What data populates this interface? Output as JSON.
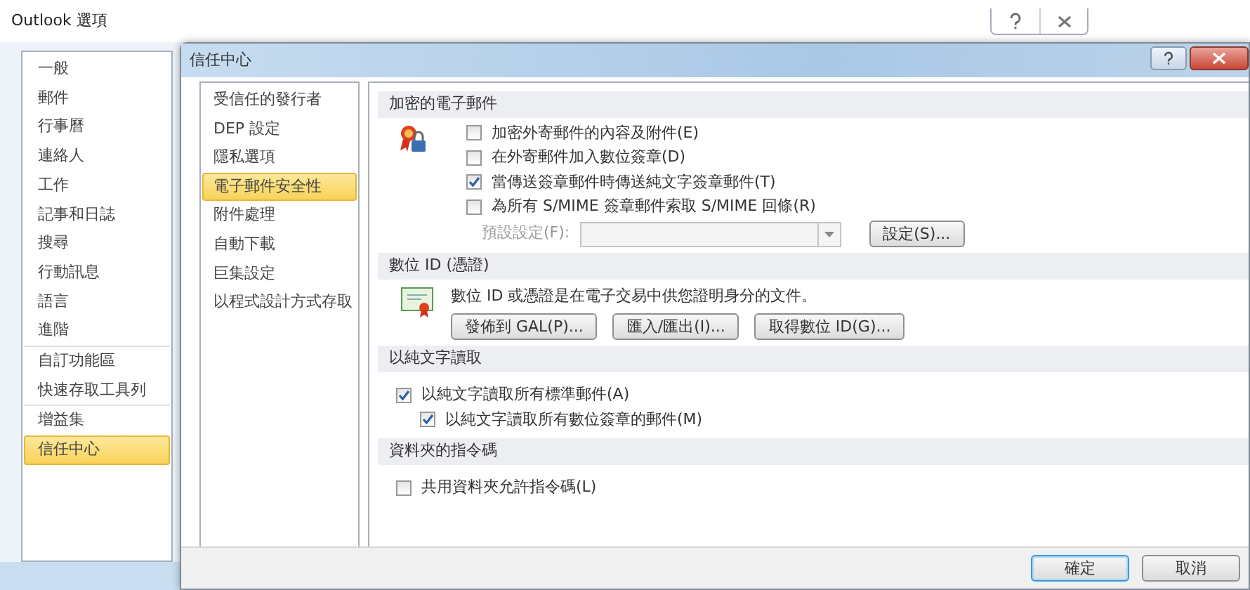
{
  "outer_window": {
    "title": "Outlook 選項",
    "nav_groups": [
      [
        {
          "label": "一般",
          "selected": false
        },
        {
          "label": "郵件",
          "selected": false
        },
        {
          "label": "行事曆",
          "selected": false
        },
        {
          "label": "連絡人",
          "selected": false
        },
        {
          "label": "工作",
          "selected": false
        },
        {
          "label": "記事和日誌",
          "selected": false
        },
        {
          "label": "搜尋",
          "selected": false
        },
        {
          "label": "行動訊息",
          "selected": false
        },
        {
          "label": "語言",
          "selected": false
        },
        {
          "label": "進階",
          "selected": false
        }
      ],
      [
        {
          "label": "自訂功能區",
          "selected": false
        },
        {
          "label": "快速存取工具列",
          "selected": false
        }
      ],
      [
        {
          "label": "增益集",
          "selected": false
        },
        {
          "label": "信任中心",
          "selected": true
        }
      ]
    ]
  },
  "dialog": {
    "title": "信任中心",
    "nav": [
      {
        "label": "受信任的發行者",
        "selected": false
      },
      {
        "label": "DEP 設定",
        "selected": false
      },
      {
        "label": "隱私選項",
        "selected": false
      },
      {
        "label": "電子郵件安全性",
        "selected": true
      },
      {
        "label": "附件處理",
        "selected": false
      },
      {
        "label": "自動下載",
        "selected": false
      },
      {
        "label": "巨集設定",
        "selected": false
      },
      {
        "label": "以程式設計方式存取",
        "selected": false
      }
    ],
    "sections": [
      {
        "kind": "encryption",
        "title": "加密的電子郵件",
        "checkboxes": [
          {
            "label": "加密外寄郵件的內容及附件(E)",
            "checked": false
          },
          {
            "label": "在外寄郵件加入數位簽章(D)",
            "checked": false
          },
          {
            "label": "當傳送簽章郵件時傳送純文字簽章郵件(T)",
            "checked": true
          },
          {
            "label": "為所有 S/MIME 簽章郵件索取 S/MIME 回條(R)",
            "checked": false
          }
        ],
        "default_setting": {
          "label": "預設設定(F):",
          "disabled": true,
          "button": "設定(S)..."
        }
      },
      {
        "kind": "digital_id",
        "title": "數位 ID (憑證)",
        "description": "數位 ID 或憑證是在電子交易中供您證明身分的文件。",
        "buttons": [
          "發佈到 GAL(P)...",
          "匯入/匯出(I)...",
          "取得數位 ID(G)..."
        ]
      },
      {
        "kind": "plain_text",
        "title": "以純文字讀取",
        "checkboxes": [
          {
            "label": "以純文字讀取所有標準郵件(A)",
            "checked": true,
            "children": [
              {
                "label": "以純文字讀取所有數位簽章的郵件(M)",
                "checked": true
              }
            ]
          }
        ]
      },
      {
        "kind": "scripts",
        "title": "資料夾的指令碼",
        "checkboxes": [
          {
            "label": "共用資料夾允許指令碼(L)",
            "checked": false
          }
        ]
      }
    ],
    "footer_buttons": [
      {
        "label": "確定",
        "default": true
      },
      {
        "label": "取消",
        "default": false
      }
    ]
  }
}
